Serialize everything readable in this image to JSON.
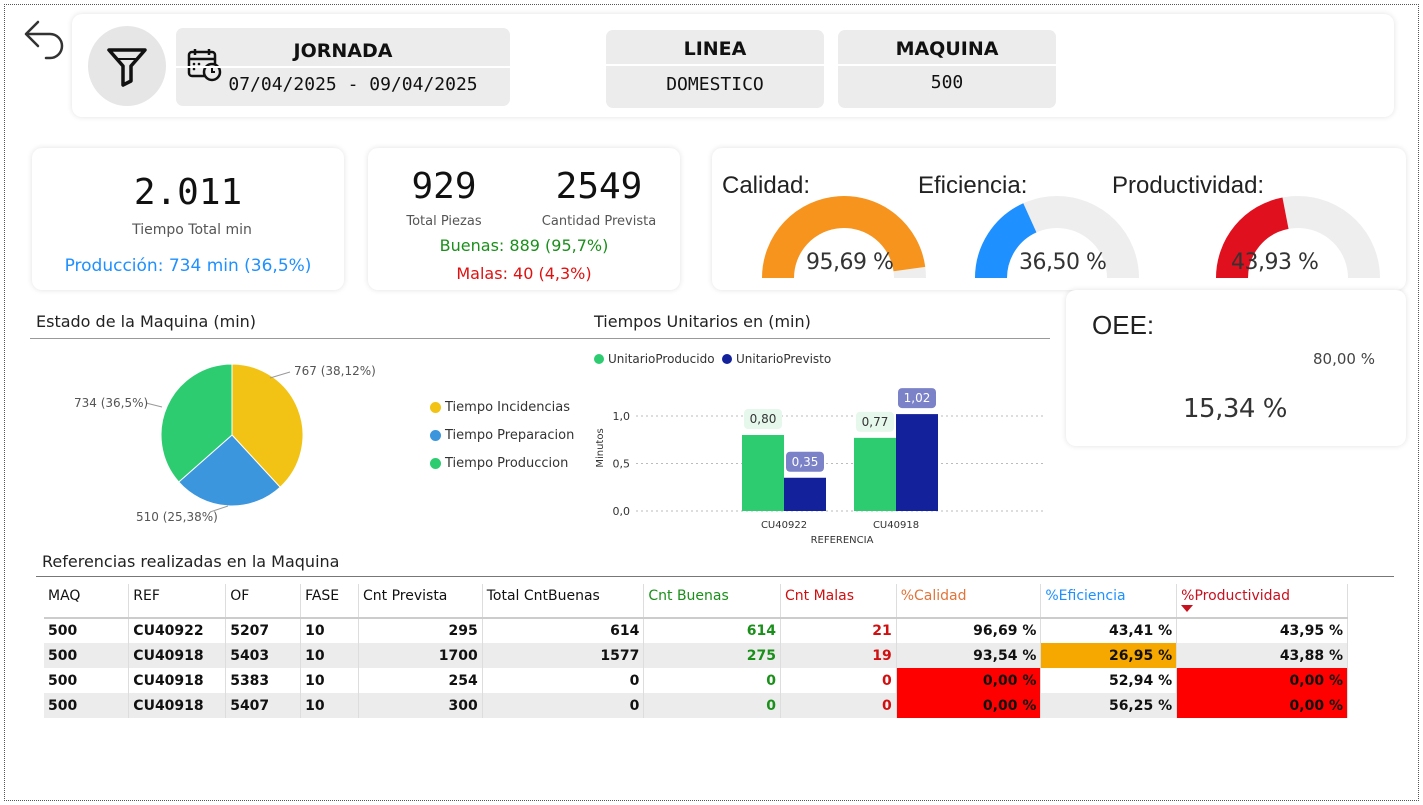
{
  "header": {
    "jornada_title": "JORNADA",
    "jornada_range": "07/04/2025 - 09/04/2025",
    "linea_title": "LINEA",
    "linea_value": "DOMESTICO",
    "maquina_title": "MAQUINA",
    "maquina_value": "500"
  },
  "kpis": {
    "tiempo_total": "2.011",
    "tiempo_total_label": "Tiempo Total min",
    "produccion_text": "Producción: 734 min (36,5%)",
    "total_piezas": "929",
    "total_piezas_label": "Total Piezas",
    "cantidad_prevista": "2549",
    "cantidad_prevista_label": "Cantidad Prevista",
    "buenas_text": "Buenas: 889 (95,7%)",
    "malas_text": "Malas: 40 (4,3%)"
  },
  "gauges": [
    {
      "title": "Calidad:",
      "value": 95.69,
      "label": "95,69 %",
      "color": "#f7941d"
    },
    {
      "title": "Eficiencia:",
      "value": 36.5,
      "label": "36,50 %",
      "color": "#1e90ff"
    },
    {
      "title": "Productividad:",
      "value": 43.93,
      "label": "43,93 %",
      "color": "#e0101e"
    }
  ],
  "oee": {
    "title": "OEE:",
    "value": 15.34,
    "label": "15,34 %",
    "target": 80.0,
    "target_label": "80,00 %",
    "color": "#7f7f7f",
    "target_color": "#1aa31a"
  },
  "estado": {
    "title": "Estado de la Maquina (min)",
    "legend": [
      {
        "label": "Tiempo Incidencias",
        "color": "#f2c314"
      },
      {
        "label": "Tiempo Preparacion",
        "color": "#3b96dd"
      },
      {
        "label": "Tiempo Produccion",
        "color": "#2ecc71"
      }
    ]
  },
  "tiempos": {
    "title": "Tiempos Unitarios en (min)",
    "legend": [
      {
        "label": "UnitarioProducido",
        "color": "#2ecc71"
      },
      {
        "label": "UnitarioPrevisto",
        "color": "#13219a"
      }
    ]
  },
  "chart_data": [
    {
      "type": "pie",
      "title": "Estado de la Maquina (min)",
      "categories": [
        "Tiempo Incidencias",
        "Tiempo Preparacion",
        "Tiempo Produccion"
      ],
      "values": [
        767,
        510,
        734
      ],
      "labels": [
        "767 (38,12%)",
        "510 (25,38%)",
        "734 (36,5%)"
      ],
      "colors": [
        "#f2c314",
        "#3b96dd",
        "#2ecc71"
      ]
    },
    {
      "type": "bar",
      "title": "Tiempos Unitarios en (min)",
      "categories": [
        "CU40922",
        "CU40918"
      ],
      "series": [
        {
          "name": "UnitarioProducido",
          "values": [
            0.8,
            0.77
          ],
          "labels": [
            "0,80",
            "0,77"
          ],
          "color": "#2ecc71"
        },
        {
          "name": "UnitarioPrevisto",
          "values": [
            0.35,
            1.02
          ],
          "labels": [
            "0,35",
            "1,02"
          ],
          "color": "#13219a"
        }
      ],
      "xlabel": "REFERENCIA",
      "ylabel": "Minutos",
      "yticks": [
        "0,0",
        "0,5",
        "1,0"
      ],
      "ylim": [
        0,
        1.1
      ]
    }
  ],
  "table": {
    "title": "Referencias realizadas en la Maquina",
    "columns": [
      "MAQ",
      "REF",
      "OF",
      "FASE",
      "Cnt Prevista",
      "Total CntBuenas",
      "Cnt Buenas",
      "Cnt Malas",
      "%Calidad",
      "%Eficiencia",
      "%Productividad"
    ],
    "header_colors": [
      "#111",
      "#111",
      "#111",
      "#111",
      "#111",
      "#111",
      "#1a8f1a",
      "#d01010",
      "#e0743a",
      "#1e90ff",
      "#c8101e"
    ],
    "rows": [
      [
        "500",
        "CU40922",
        "5207",
        "10",
        "295",
        "614",
        "614",
        "21",
        "96,69 %",
        "43,41 %",
        "43,95 %"
      ],
      [
        "500",
        "CU40918",
        "5403",
        "10",
        "1700",
        "1577",
        "275",
        "19",
        "93,54 %",
        "26,95 %",
        "43,88 %"
      ],
      [
        "500",
        "CU40918",
        "5383",
        "10",
        "254",
        "0",
        "0",
        "0",
        "0,00 %",
        "52,94 %",
        "0,00 %"
      ],
      [
        "500",
        "CU40918",
        "5407",
        "10",
        "300",
        "0",
        "0",
        "0",
        "0,00 %",
        "56,25 %",
        "0,00 %"
      ]
    ],
    "cell_bg": [
      [
        null,
        null,
        null,
        null,
        null,
        null,
        null,
        null,
        null,
        null,
        null
      ],
      [
        null,
        null,
        null,
        null,
        null,
        null,
        null,
        null,
        null,
        "#f7a800",
        null
      ],
      [
        null,
        null,
        null,
        null,
        null,
        null,
        null,
        null,
        "#ff0000",
        null,
        "#ff0000"
      ],
      [
        null,
        null,
        null,
        null,
        null,
        null,
        null,
        null,
        "#ff0000",
        null,
        "#ff0000"
      ]
    ]
  },
  "colors": {
    "accent_blue": "#1e90ff",
    "good_green": "#1a8f1a",
    "bad_red": "#e01010"
  }
}
